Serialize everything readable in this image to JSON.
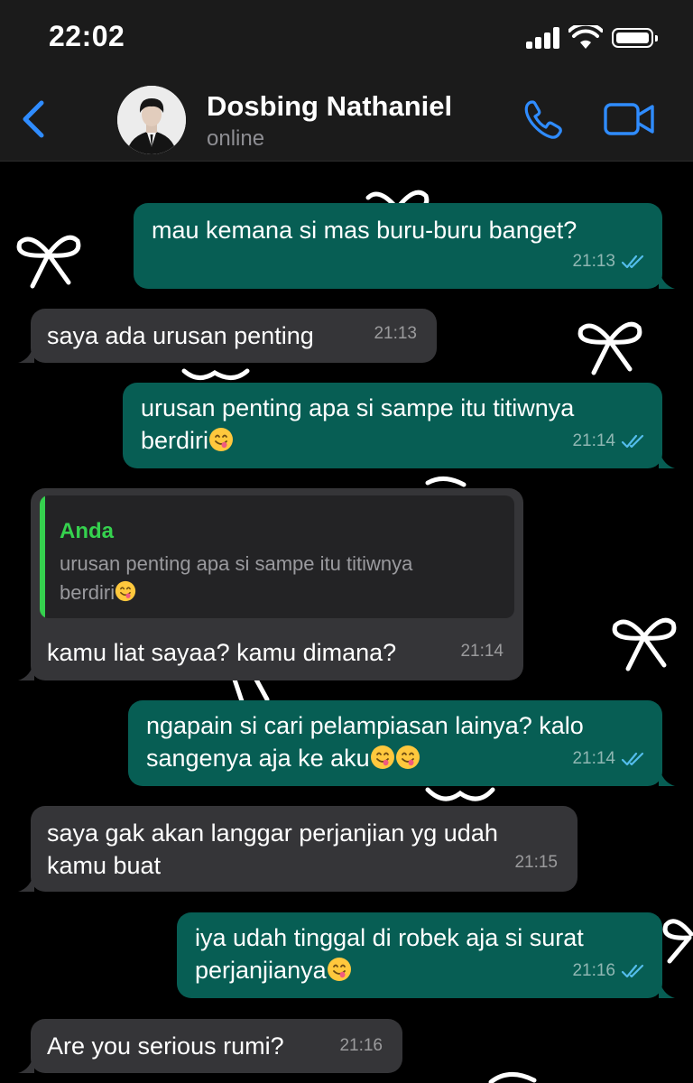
{
  "status_bar": {
    "time": "22:02"
  },
  "header": {
    "contact_name": "Dosbing Nathaniel",
    "contact_status": "online",
    "icons": {
      "back": "chevron-left-icon",
      "call": "phone-icon",
      "video": "video-camera-icon"
    },
    "accent_color": "#2f8cff"
  },
  "colors": {
    "outgoing_bubble": "#075e54",
    "incoming_bubble": "#353538",
    "quote_accent": "#35d14e",
    "read_ticks": "#53bdeb"
  },
  "messages": [
    {
      "direction": "outgoing",
      "lines": [
        "mau kemana si mas buru-buru banget?"
      ],
      "time": "21:13",
      "status": "read"
    },
    {
      "direction": "incoming",
      "lines": [
        "saya ada urusan penting"
      ],
      "time": "21:13"
    },
    {
      "direction": "outgoing",
      "lines": [
        "urusan penting apa si sampe itu titiwnya",
        "berdiri"
      ],
      "emoji_after": "yum-face-emoji",
      "time": "21:14",
      "status": "read"
    },
    {
      "direction": "incoming",
      "quote": {
        "author": "Anda",
        "lines": [
          "urusan penting apa si sampe itu titiwnya",
          "berdiri"
        ],
        "emoji_after": "yum-face-emoji"
      },
      "lines": [
        "kamu liat sayaa? kamu dimana?"
      ],
      "time": "21:14"
    },
    {
      "direction": "outgoing",
      "lines": [
        "ngapain si cari pelampiasan lainya? kalo",
        "sangenya aja ke aku"
      ],
      "emoji_after": "yum-face-emoji x2",
      "time": "21:14",
      "status": "read"
    },
    {
      "direction": "incoming",
      "lines": [
        "saya gak akan langgar perjanjian yg udah",
        "kamu buat"
      ],
      "time": "21:15"
    },
    {
      "direction": "outgoing",
      "lines": [
        "iya udah tinggal di robek aja si surat",
        "perjanjianya"
      ],
      "emoji_after": "yum-face-emoji",
      "time": "21:16",
      "status": "read"
    },
    {
      "direction": "incoming",
      "lines": [
        "Are you serious rumi?"
      ],
      "time": "21:16"
    }
  ]
}
